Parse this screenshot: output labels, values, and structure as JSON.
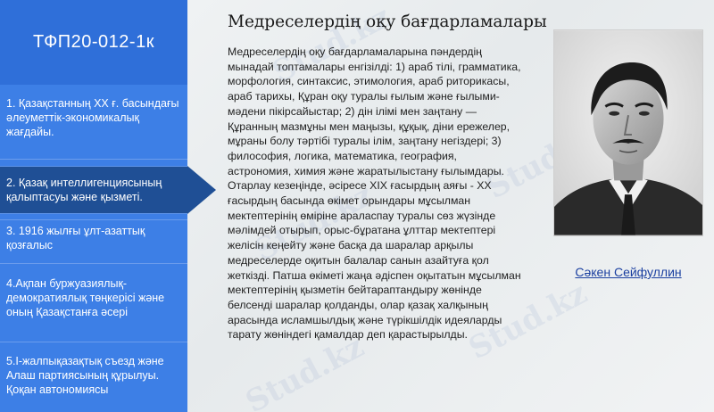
{
  "sidebar": {
    "title": "ТФП20-012-1к",
    "items": [
      {
        "label": "1. Қазақстанның ХХ ғ. басындағы әлеуметтік-экономикалық жағдайы."
      },
      {
        "label": "2. Қазақ интеллигенциясының қалыптасуы және қызметі."
      },
      {
        "label": "3. 1916 жылғы ұлт-азаттық қозғалыс"
      },
      {
        "label": "4.Ақпан буржуазиялық-демократиялық төңкерісі және оның Қазақстанға әсері"
      },
      {
        "label": "5.І-жалпықазақтық съезд және Алаш партиясының құрылуы. Қоқан автономиясы"
      }
    ],
    "active_index": 1
  },
  "main": {
    "title": "Медреселердің оқу бағдарламалары",
    "body": "Медреселердің оқу бағдарламаларына пәндердің мынадай топтамалары енгізілді: 1) араб тілі, грамматика, морфология, синтаксис, этимология, араб риторикасы, араб тарихы, Құран оқу туралы ғылым және ғылыми-мәдени пікірсайыстар; 2) дін ілімі мен заңтану — Құранның мазмұны мен маңызы, құқық, діни ережелер, мұраны болу тәртібі туралы ілім, заңтану негіздері; 3) философия, логика, математика, география, астрономия, химия және жаратылыстану ғылымдары. Отарлау кезеңінде, әсіресе XIX ғасырдың аяғы - XX ғасырдың басында өкімет орындары мұсылман мектептерінің өміріне араласпау туралы сөз жүзінде мәлімдей отырып, орыс-бұратана ұлттар мектептері желісін кеңейту және басқа да шаралар арқылы медреселерде оқитын балалар санын азайтуға қол жеткізді. Патша өкіметі жаңа әдіспен оқытатын мұсылман мектептерінің қызметін бейтараптандыру жөнінде белсенді шаралар қолданды, олар қазақ халқының арасында исламшылдық және түрікшілдік идеяларды тарату жөніндегі қамалдар деп қарастырылды."
  },
  "portrait": {
    "caption": "Сәкен Сейфуллин"
  },
  "watermark": {
    "text": "Stud.kz"
  },
  "colors": {
    "sidebar": "#3d7fe6",
    "sidebar_title": "#2f6fd9",
    "active_item": "#1f4f95",
    "caption": "#1a3fa0"
  }
}
